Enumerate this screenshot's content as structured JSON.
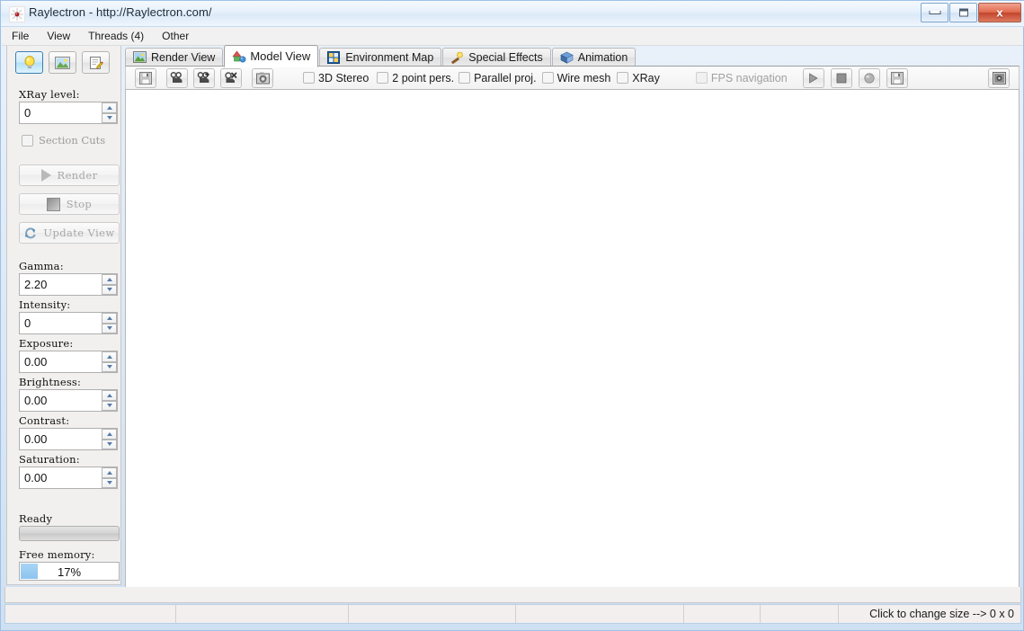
{
  "window": {
    "title": "Raylectron - http://Raylectron.com/",
    "app_icon": "starburst-icon",
    "controls": {
      "minimize": "minimize-button",
      "maximize": "maximize-button",
      "close_label": "x"
    }
  },
  "menu": {
    "items": [
      {
        "label": "File"
      },
      {
        "label": "View"
      },
      {
        "label": "Threads (4)"
      },
      {
        "label": "Other"
      }
    ]
  },
  "sidebar": {
    "tools": [
      {
        "name": "lightbulb-icon",
        "selected": true
      },
      {
        "name": "image-icon",
        "selected": false
      },
      {
        "name": "edit-document-icon",
        "selected": false
      }
    ],
    "xray_level": {
      "label": "XRay level:",
      "value": "0"
    },
    "section_cuts": {
      "label": "Section Cuts",
      "checked": false
    },
    "buttons": [
      {
        "label": "Render",
        "icon": "play-icon",
        "enabled": false
      },
      {
        "label": "Stop",
        "icon": "stop-icon",
        "enabled": false
      },
      {
        "label": "Update View",
        "icon": "refresh-icon",
        "enabled": false
      }
    ],
    "fields": [
      {
        "label": "Gamma:",
        "value": "2.20"
      },
      {
        "label": "Intensity:",
        "value": "0"
      },
      {
        "label": "Exposure:",
        "value": "0.00"
      },
      {
        "label": "Brightness:",
        "value": "0.00"
      },
      {
        "label": "Contrast:",
        "value": "0.00"
      },
      {
        "label": "Saturation:",
        "value": "0.00"
      }
    ],
    "status_label": "Ready",
    "progress_percent": 0,
    "free_memory": {
      "label": "Free memory:",
      "value": "17%",
      "percent": 17
    }
  },
  "tabs": [
    {
      "label": "Render View",
      "icon": "picture-icon",
      "active": false
    },
    {
      "label": "Model View",
      "icon": "model-house-icon",
      "active": true
    },
    {
      "label": "Environment Map",
      "icon": "env-map-icon",
      "active": false
    },
    {
      "label": "Special Effects",
      "icon": "magic-wand-icon",
      "active": false
    },
    {
      "label": "Animation",
      "icon": "cube-icon",
      "active": false
    }
  ],
  "toolbar": {
    "buttons": [
      {
        "name": "save-icon"
      },
      {
        "name": "camera-icon"
      },
      {
        "name": "camera-add-icon"
      },
      {
        "name": "camera-delete-icon"
      },
      {
        "name": "snapshot-icon"
      }
    ],
    "checkboxes": [
      {
        "label": "3D Stereo",
        "checked": false,
        "enabled": true
      },
      {
        "label": "2 point pers.",
        "checked": false,
        "enabled": true
      },
      {
        "label": "Parallel proj.",
        "checked": false,
        "enabled": true
      },
      {
        "label": "Wire mesh",
        "checked": false,
        "enabled": true
      },
      {
        "label": "XRay",
        "checked": false,
        "enabled": true
      },
      {
        "label": "FPS navigation",
        "checked": false,
        "enabled": false
      }
    ],
    "media_buttons": [
      {
        "name": "play-icon"
      },
      {
        "name": "stop-icon"
      },
      {
        "name": "sphere-icon"
      },
      {
        "name": "save-icon"
      }
    ],
    "right_button": {
      "name": "view-settings-icon"
    }
  },
  "statusbar": {
    "cells": [
      "",
      "",
      "",
      "",
      "",
      "",
      "Click to change size --> 0 x 0"
    ]
  },
  "colors": {
    "accent": "#3c7fb1",
    "memory_fill": "#8cc4ef",
    "close_button": "#c3442c",
    "viewport_bg": "#ffffff"
  }
}
